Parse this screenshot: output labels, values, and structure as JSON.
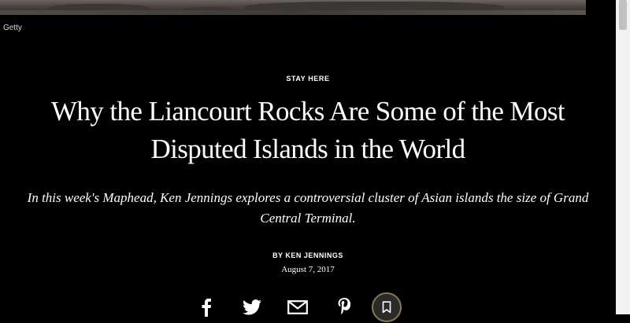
{
  "hero": {
    "credit": "Getty"
  },
  "article": {
    "rubric": "STAY HERE",
    "headline_line1": "Why the Liancourt Rocks Are Some of the Most",
    "headline_line2": "Disputed Islands in the World",
    "dek_line1": "In this week's Maphead, Ken Jennings explores a controversial cluster of Asian islands the size of Grand",
    "dek_line2": "Central Terminal.",
    "byline": "BY KEN JENNINGS",
    "date": "August 7, 2017"
  },
  "share": {
    "icons": [
      "facebook-icon",
      "twitter-icon",
      "email-icon",
      "pinterest-icon",
      "bookmark-icon"
    ],
    "bookmark_ring_color": "#8a7a45"
  }
}
